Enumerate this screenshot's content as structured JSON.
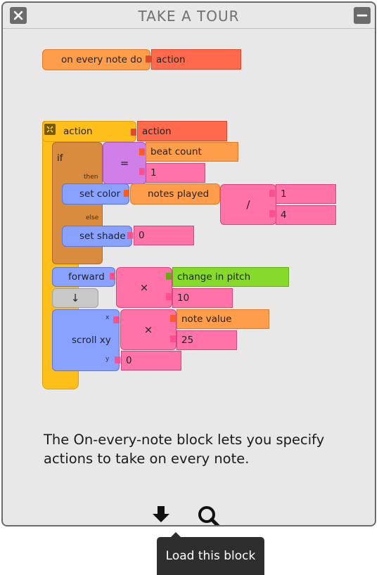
{
  "dialog": {
    "title": "TAKE A TOUR",
    "close_icon": "close-icon",
    "minimize_icon": "minimize-icon"
  },
  "blocks": {
    "on_every_note": "on every note do",
    "on_every_note_arg": "action",
    "action_label": "action",
    "action_arg": "action",
    "if_label": "if",
    "then_label": "then",
    "else_label": "else",
    "eq_op": "=",
    "beat_count": "beat count",
    "num_one": "1",
    "set_color": "set color",
    "notes_played": "notes played",
    "div_op": "/",
    "div_num": "1",
    "div_den": "4",
    "set_shade": "set shade",
    "shade_val": "0",
    "forward": "forward",
    "mul_op1": "×",
    "change_in_pitch": "change in pitch",
    "mul_val1": "10",
    "down_arrow": "↓",
    "scroll_xy": "scroll xy",
    "x_label": "x",
    "y_label": "y",
    "mul_op2": "×",
    "note_value": "note value",
    "mul_val2": "25",
    "y_val": "0"
  },
  "description": "The On-every-note block lets you specify actions to take on every note.",
  "toolbar": {
    "download_icon": "download-icon",
    "search_icon": "search-icon"
  },
  "tooltip": "Load this block"
}
